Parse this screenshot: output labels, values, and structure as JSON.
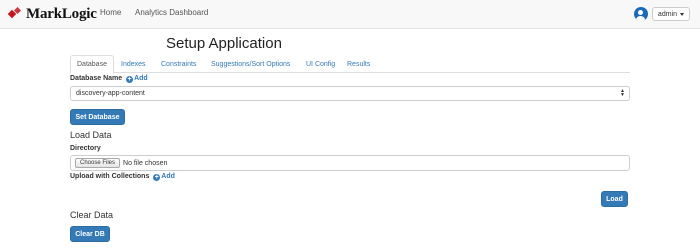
{
  "navbar": {
    "brand": "MarkLogic",
    "links": [
      "Home",
      "Analytics Dashboard"
    ],
    "user": "admin"
  },
  "title": "Setup Application",
  "tabs": [
    "Database",
    "Indexes",
    "Constraints",
    "Suggestions/Sort Options",
    "UI Config",
    "Results"
  ],
  "active_tab": "Database",
  "database": {
    "label": "Database Name",
    "add_label": "Add",
    "selected": "discovery-app-content",
    "set_button": "Set Database"
  },
  "load": {
    "heading": "Load Data",
    "directory_label": "Directory",
    "choose_files": "Choose Files",
    "no_file": "No file chosen",
    "collections_label": "Upload with Collections",
    "add_label": "Add",
    "load_button": "Load"
  },
  "clear": {
    "heading": "Clear Data",
    "button": "Clear DB"
  },
  "colors": {
    "primary": "#337ab7",
    "brand_red": "#c4161c",
    "navbar_bg": "#f8f8f8"
  }
}
